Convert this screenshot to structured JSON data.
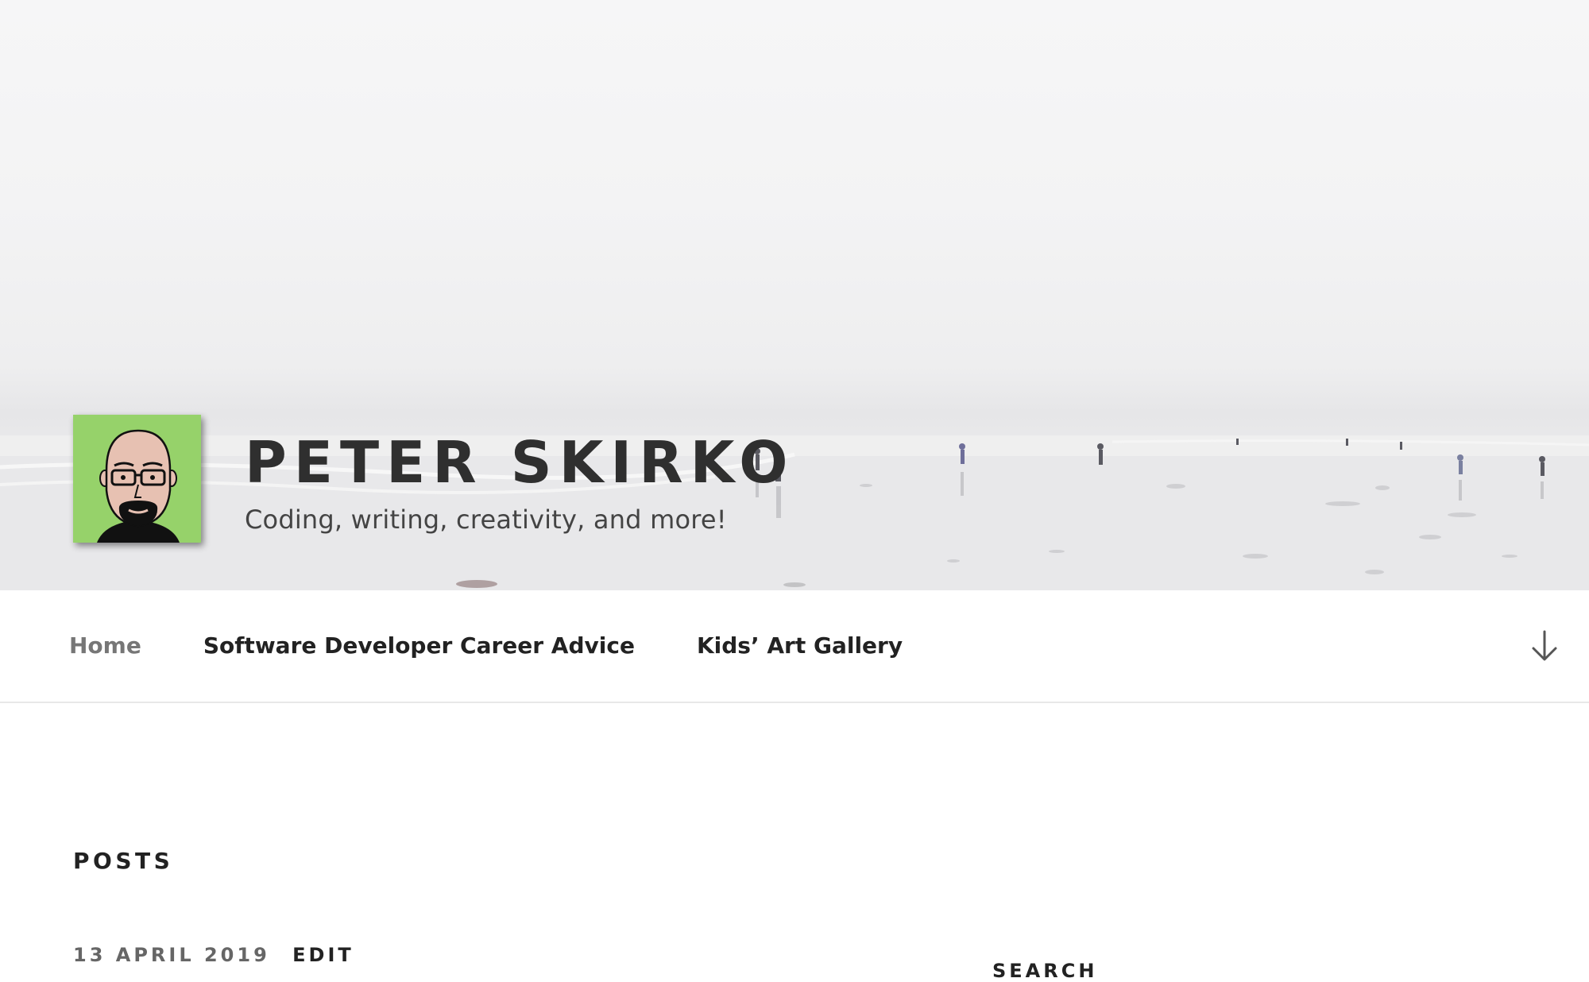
{
  "header": {
    "site_title": "PETER SKIRKO",
    "site_description": "Coding, writing, creativity, and more!",
    "logo_icon": "avatar-cartoon-bald-glasses-goatee",
    "logo_background": "#96d26a"
  },
  "nav": {
    "items": [
      {
        "label": "Home",
        "current": true
      },
      {
        "label": "Software Developer Career Advice",
        "current": false
      },
      {
        "label": "Kids’ Art Gallery",
        "current": false
      }
    ],
    "scroll_icon": "arrow-down-icon"
  },
  "main": {
    "section_heading": "POSTS",
    "first_post": {
      "date": "13 APRIL 2019",
      "edit_label": "EDIT"
    }
  },
  "sidebar": {
    "search_heading": "SEARCH"
  }
}
